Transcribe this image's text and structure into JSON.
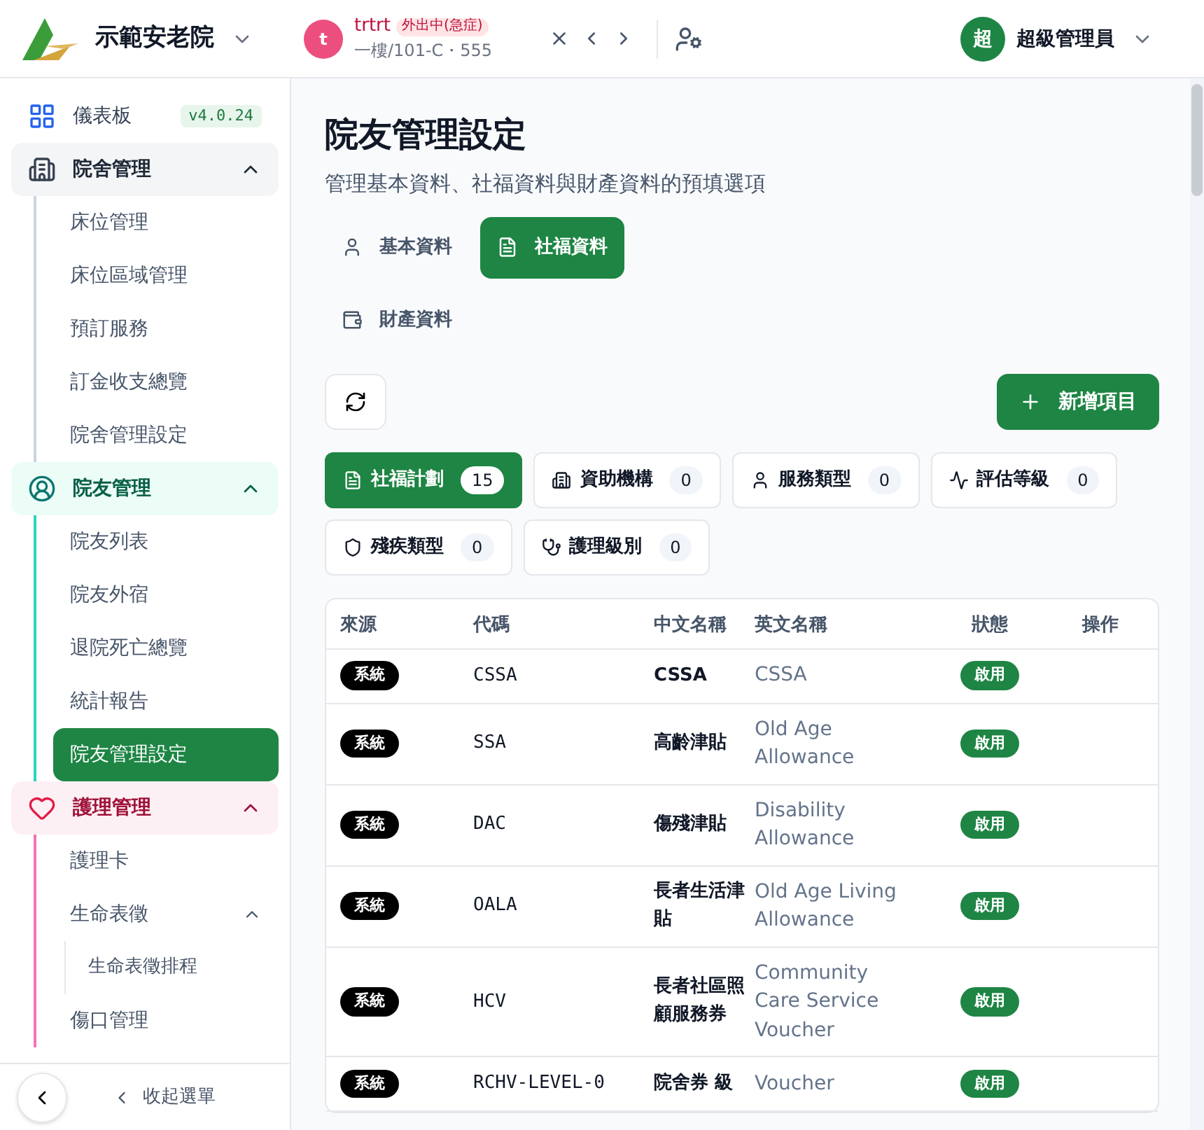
{
  "header": {
    "org_name": "示範安老院",
    "resident": {
      "avatar": "t",
      "name": "trtrt",
      "status": "外出中(急症)",
      "location": "一樓/101-C・555"
    },
    "user": {
      "avatar": "超",
      "name": "超級管理員"
    }
  },
  "sidebar": {
    "version": "v4.0.24",
    "items": [
      {
        "label": "儀表板",
        "kind": "link",
        "selected": false
      },
      {
        "label": "院舍管理",
        "kind": "group",
        "expanded": true,
        "children": [
          {
            "label": "床位管理",
            "selected": false
          },
          {
            "label": "床位區域管理",
            "selected": false
          },
          {
            "label": "預訂服務",
            "selected": false
          },
          {
            "label": "訂金收支總覽",
            "selected": false
          },
          {
            "label": "院舍管理設定",
            "selected": false
          }
        ]
      },
      {
        "label": "院友管理",
        "kind": "group",
        "expanded": true,
        "children": [
          {
            "label": "院友列表",
            "selected": false
          },
          {
            "label": "院友外宿",
            "selected": false
          },
          {
            "label": "退院死亡總覽",
            "selected": false
          },
          {
            "label": "統計報告",
            "selected": false
          },
          {
            "label": "院友管理設定",
            "selected": true
          }
        ]
      },
      {
        "label": "護理管理",
        "kind": "group",
        "expanded": true,
        "children": [
          {
            "label": "護理卡",
            "selected": false
          },
          {
            "label": "生命表徵",
            "selected": false,
            "expanded": true,
            "children": [
              {
                "label": "生命表徵排程",
                "selected": false
              }
            ]
          },
          {
            "label": "傷口管理",
            "selected": false
          }
        ]
      }
    ],
    "collapse_label": "收起選單"
  },
  "page": {
    "title": "院友管理設定",
    "subtitle": "管理基本資料、社福資料與財產資料的預填選項"
  },
  "tabs": [
    {
      "label": "基本資料",
      "selected": false
    },
    {
      "label": "社福資料",
      "selected": true
    },
    {
      "label": "財產資料",
      "selected": false
    }
  ],
  "add_button": "新增項目",
  "categories": [
    {
      "label": "社福計劃",
      "count": "15",
      "selected": true
    },
    {
      "label": "資助機構",
      "count": "0",
      "selected": false
    },
    {
      "label": "服務類型",
      "count": "0",
      "selected": false
    },
    {
      "label": "評估等級",
      "count": "0",
      "selected": false
    },
    {
      "label": "殘疾類型",
      "count": "0",
      "selected": false
    },
    {
      "label": "護理級別",
      "count": "0",
      "selected": false
    }
  ],
  "table": {
    "columns": [
      "來源",
      "代碼",
      "中文名稱",
      "英文名稱",
      "狀態",
      "操作"
    ],
    "rows": [
      {
        "source": "系統",
        "code": "CSSA",
        "name_zh": "CSSA",
        "name_en": "CSSA",
        "status": "啟用",
        "enabled": true
      },
      {
        "source": "系統",
        "code": "SSA",
        "name_zh": "高齡津貼",
        "name_en": "Old Age Allowance",
        "status": "啟用",
        "enabled": true
      },
      {
        "source": "系統",
        "code": "DAC",
        "name_zh": "傷殘津貼",
        "name_en": "Disability Allowance",
        "status": "啟用",
        "enabled": true
      },
      {
        "source": "系統",
        "code": "OALA",
        "name_zh": "長者生活津貼",
        "name_en": "Old Age Living Allowance",
        "status": "啟用",
        "enabled": true
      },
      {
        "source": "系統",
        "code": "HCV",
        "name_zh": "長者社區照顧服務券",
        "name_en": "Community Care Service Voucher",
        "status": "啟用",
        "enabled": true
      },
      {
        "source": "系統",
        "code": "RCHV-LEVEL-0",
        "name_zh": "院舍券 級",
        "name_en": "Voucher",
        "status": "啟用",
        "enabled": true
      }
    ]
  }
}
